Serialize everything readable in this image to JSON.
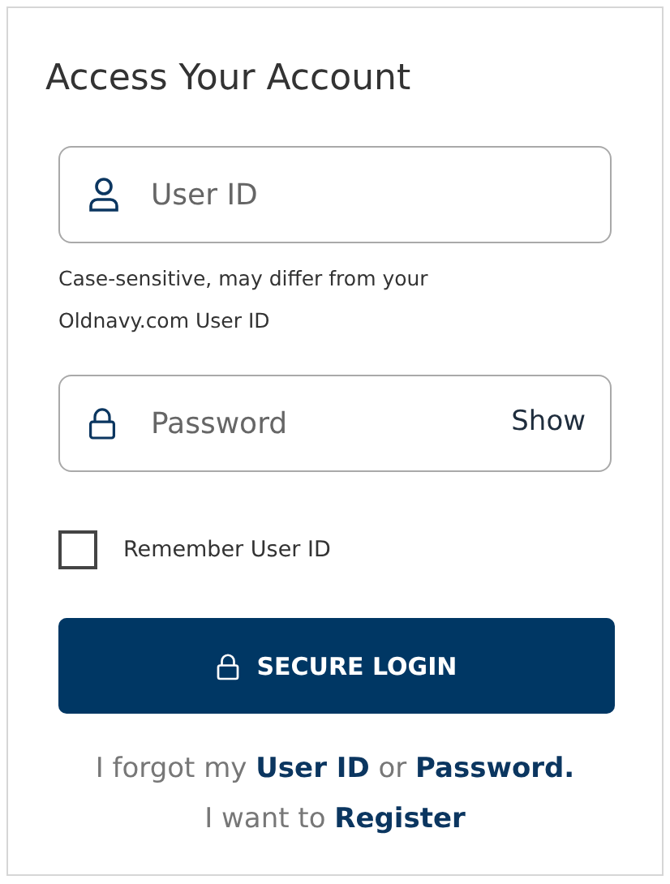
{
  "title": "Access Your Account",
  "user_field": {
    "placeholder": "User ID"
  },
  "user_hint": "Case-sensitive, may differ from your Oldnavy.com User ID",
  "password_field": {
    "placeholder": "Password",
    "show_label": "Show"
  },
  "remember": {
    "label": "Remember User ID",
    "checked": false
  },
  "login_button": "SECURE LOGIN",
  "forgot": {
    "prefix": "I forgot my",
    "user_link": "User ID",
    "middle": "or",
    "password_link": "Password."
  },
  "register": {
    "prefix": "I want to",
    "link": "Register"
  }
}
